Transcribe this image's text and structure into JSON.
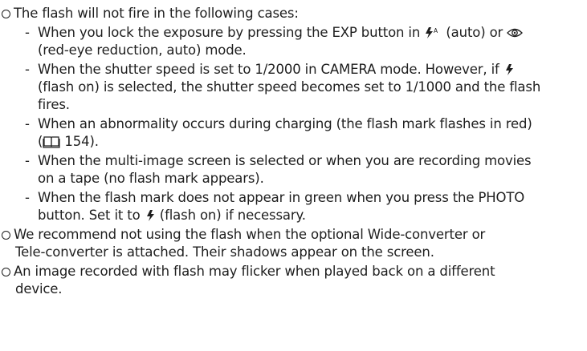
{
  "intro": "The flash will not fire in the following cases:",
  "cases": {
    "c1_a": "When you lock the exposure by pressing the EXP button in",
    "c1_b": "(auto) or",
    "c1_c": "(red-eye reduction, auto) mode.",
    "c2_a": "When the shutter speed is set to 1/2000 in CAMERA mode. However, if",
    "c2_b": "(flash on) is selected, the shutter speed becomes set to 1/1000 and the flash",
    "c2_c": "fires.",
    "c3_a": "When an abnormality occurs during charging (the flash mark flashes in red)",
    "c3_b": "154).",
    "c4_a": "When the multi-image screen is selected or when you are recording movies",
    "c4_b": "on a tape (no flash mark appears).",
    "c5_a": "When the flash mark does not appear in green when you press the PHOTO",
    "c5_b": "button. Set it to",
    "c5_c": "(flash on) if necessary."
  },
  "note2": {
    "a": "We recommend not using the flash when the optional Wide-converter or",
    "b": "Tele-converter is attached. Their shadows appear on the screen."
  },
  "note3": {
    "a": "An image recorded with flash may flicker when played back on a different",
    "b": "device."
  },
  "icons": [
    "flash-auto-icon",
    "red-eye-icon",
    "flash-icon",
    "book-icon"
  ]
}
